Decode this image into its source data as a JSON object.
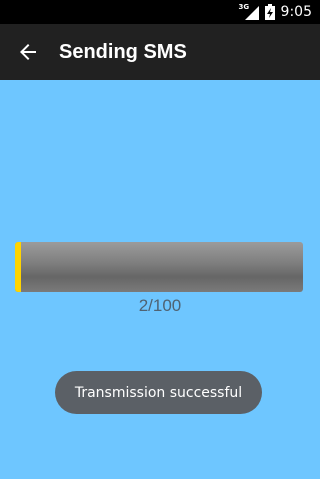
{
  "status_bar": {
    "network_type": "3G",
    "time": "9:05"
  },
  "app_bar": {
    "back_icon": "arrow-back-icon",
    "title": "Sending SMS"
  },
  "progress": {
    "text": "2/100",
    "fraction": 0.02
  },
  "toast": {
    "message": "Transmission successful"
  },
  "colors": {
    "background": "#6ec6ff",
    "app_bar": "#212121",
    "progress_fill": "#ffd400"
  }
}
